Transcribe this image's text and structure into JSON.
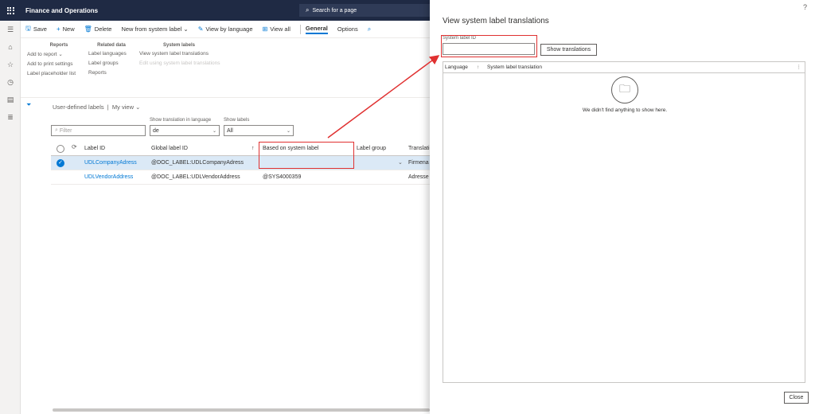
{
  "app": {
    "title": "Finance and Operations",
    "search_placeholder": "Search for a page"
  },
  "leftnav": {
    "items": [
      "hamburger-icon",
      "home-icon",
      "star-icon",
      "clock-icon",
      "workspace-icon",
      "list-icon"
    ]
  },
  "actionpane": {
    "save": "Save",
    "new": "New",
    "delete": "Delete",
    "new_from_system_label": "New from system label",
    "view_by_language": "View by language",
    "view_all": "View all",
    "tab_general": "General",
    "tab_options": "Options"
  },
  "ribbon": {
    "reports": {
      "header": "Reports",
      "items": [
        "Add to report",
        "Add to print settings",
        "Label placeholder list"
      ]
    },
    "related": {
      "header": "Related data",
      "items": [
        "Label languages",
        "Label groups",
        "Reports"
      ]
    },
    "system": {
      "header": "System labels",
      "items": [
        "View system label translations",
        "Edit using system label translations"
      ]
    }
  },
  "view": {
    "title": "User-defined labels",
    "sep": "|",
    "myview": "My view"
  },
  "filters": {
    "filter_placeholder": "Filter",
    "lang_label": "Show translation in language",
    "lang_value": "de",
    "show_label": "Show labels",
    "show_value": "All"
  },
  "grid": {
    "headers": [
      "Label ID",
      "Global label ID",
      "Based on system label",
      "Label group",
      "Translatio"
    ],
    "rows": [
      {
        "label_id": "UDLCompanyAdress",
        "global": "@DOC_LABEL:UDLCompanyAdress",
        "based": "",
        "group": "",
        "translation": "Firmena"
      },
      {
        "label_id": "UDLVendorAddress",
        "global": "@DOC_LABEL:UDLVendorAddress",
        "based": "@SYS4000359",
        "group": "",
        "translation": "Adresse"
      }
    ]
  },
  "panel": {
    "title": "View system label translations",
    "help": "?",
    "sid_label": "System label ID",
    "sid_value": "",
    "show_button": "Show translations",
    "col_language": "Language",
    "col_translation": "System label translation",
    "empty": "We didn't find anything to show here.",
    "close": "Close"
  },
  "colors": {
    "accent": "#0078d4",
    "topbar": "#1f2a44",
    "highlight": "#e03131"
  }
}
